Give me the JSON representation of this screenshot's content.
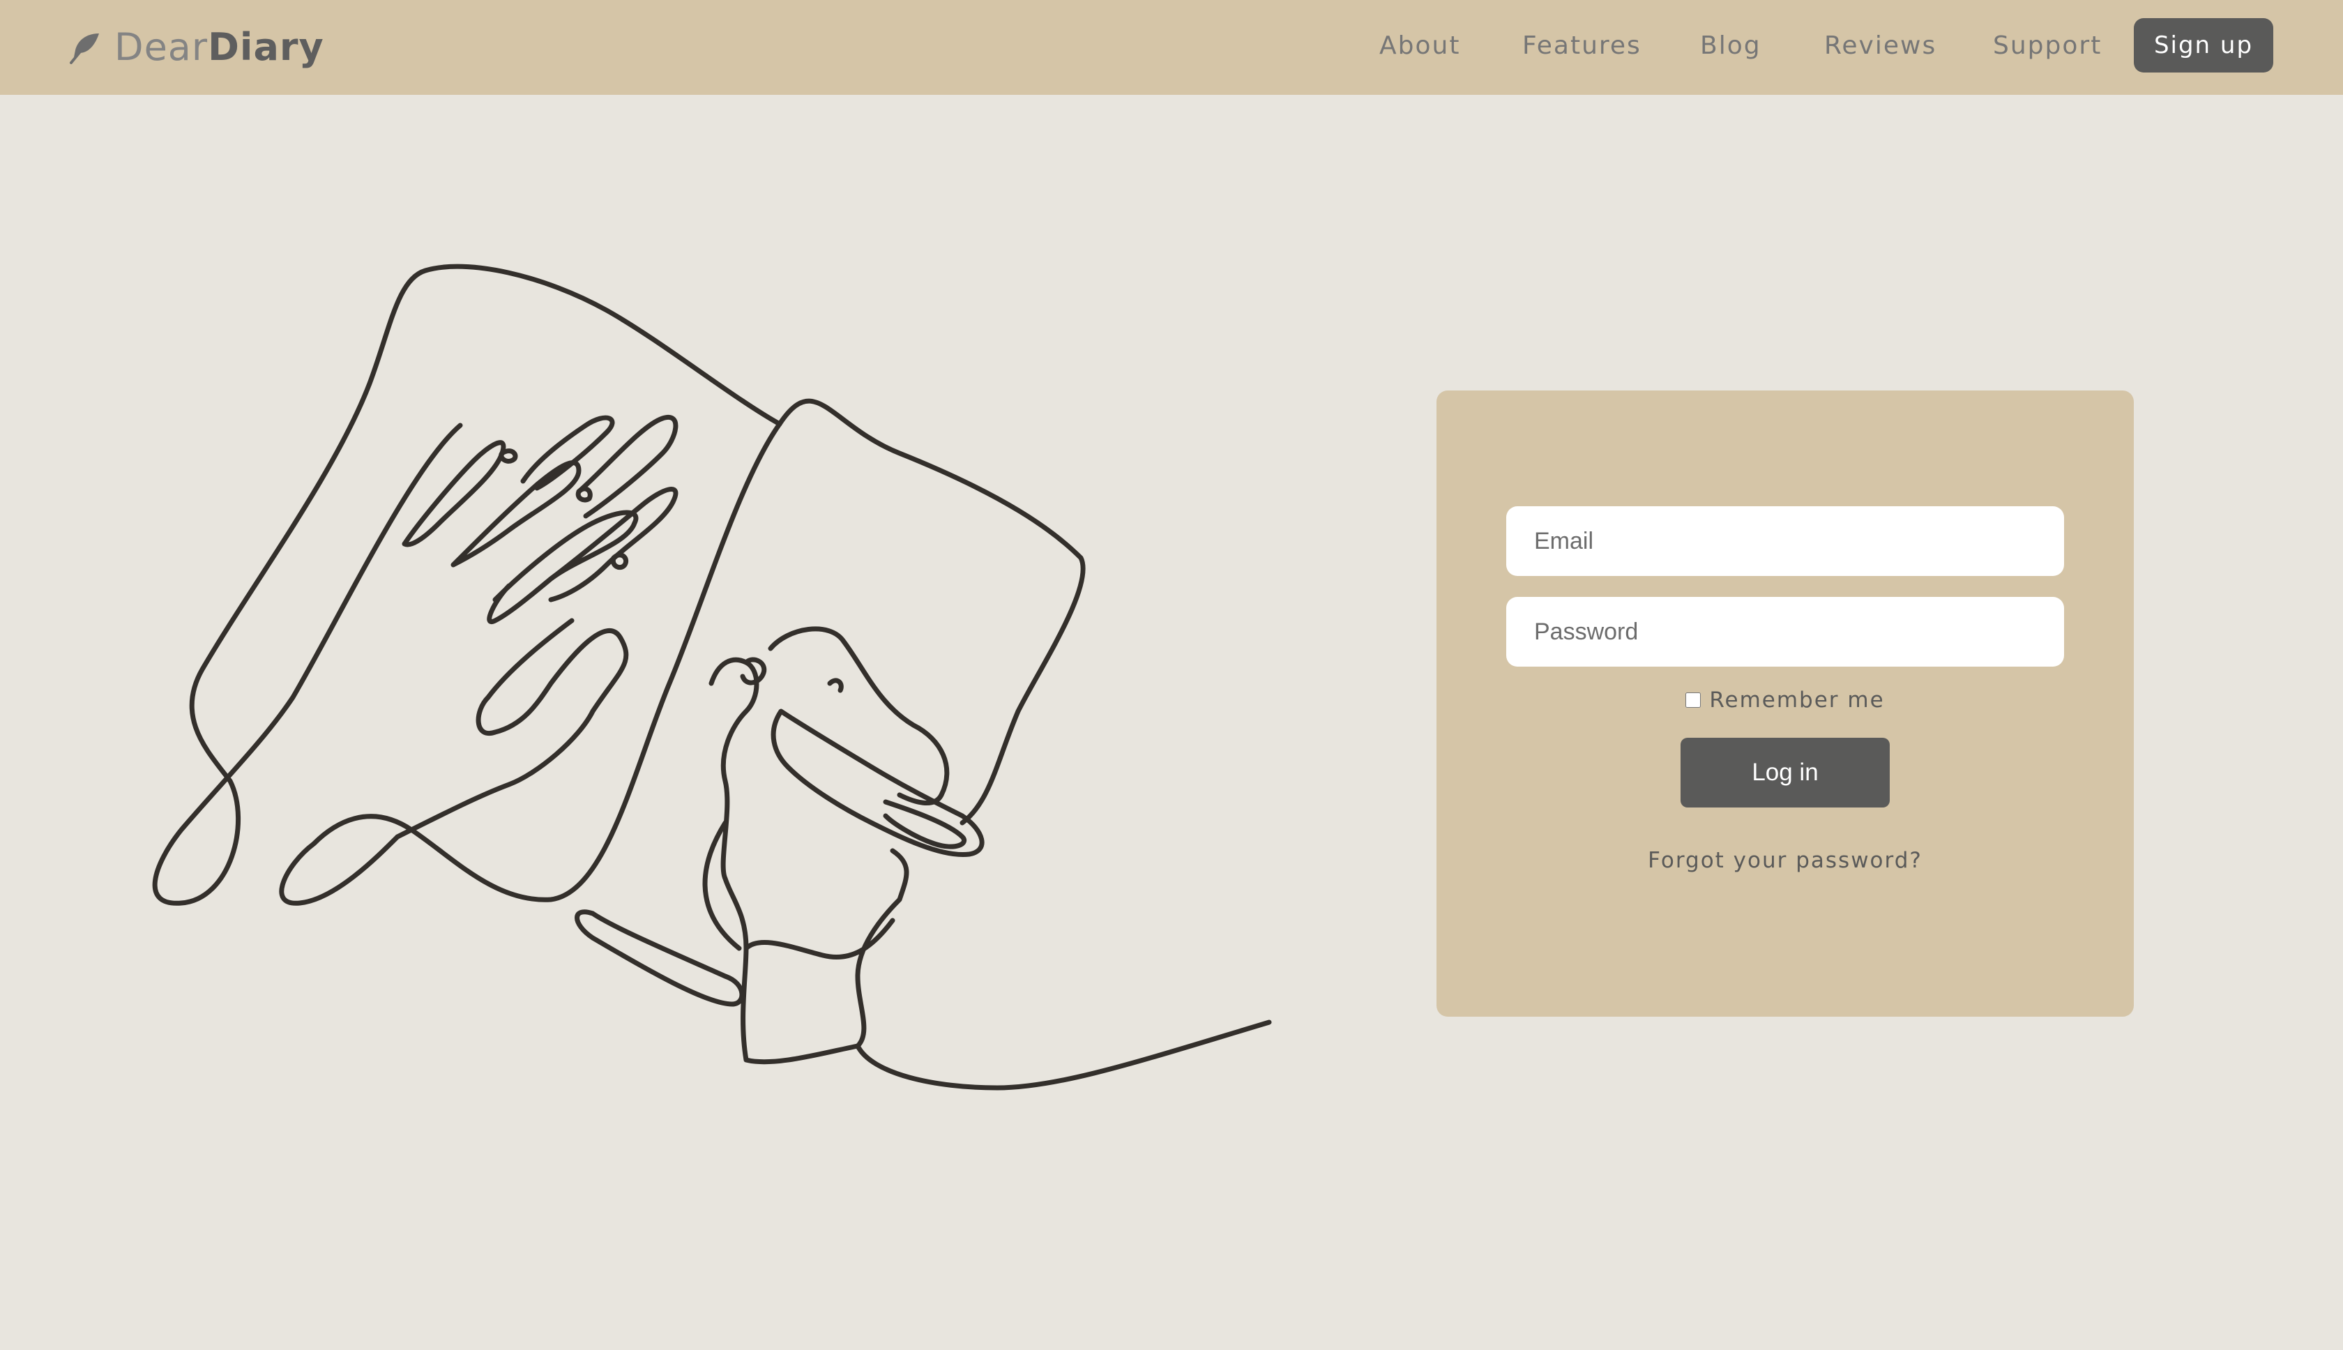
{
  "brand": {
    "name_light": "Dear",
    "name_bold": "Diary",
    "icon": "feather-icon"
  },
  "nav": {
    "items": [
      {
        "label": "About"
      },
      {
        "label": "Features"
      },
      {
        "label": "Blog"
      },
      {
        "label": "Reviews"
      },
      {
        "label": "Support"
      }
    ],
    "signup_label": "Sign up"
  },
  "login": {
    "email_placeholder": "Email",
    "password_placeholder": "Password",
    "remember_label": "Remember me",
    "login_label": "Log in",
    "forgot_label": "Forgot your password?"
  },
  "colors": {
    "header_bg": "#d5c5a7",
    "page_bg": "#e8e5de",
    "button_bg": "#5a5a59",
    "line_art": "#332f2b"
  }
}
